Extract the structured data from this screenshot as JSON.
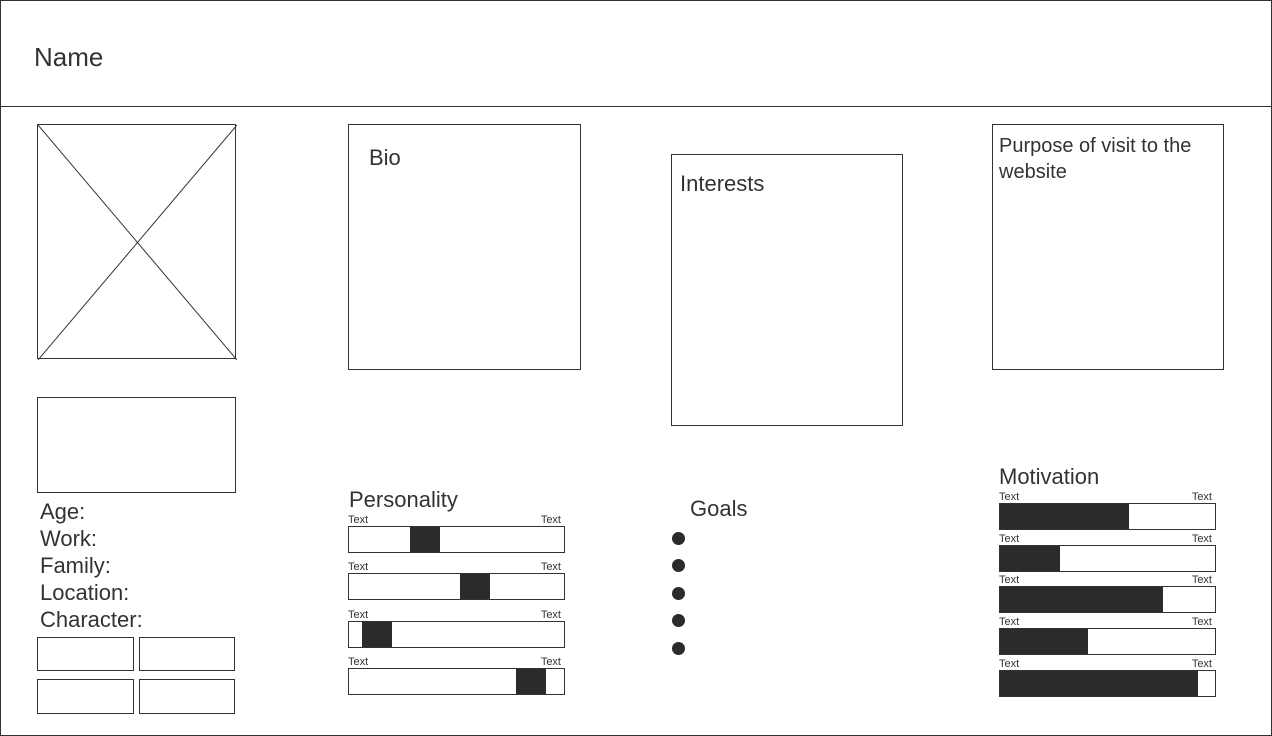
{
  "header": {
    "name": "Name"
  },
  "bio": {
    "title": "Bio"
  },
  "interests": {
    "title": "Interests"
  },
  "purpose": {
    "title": "Purpose of visit to the website"
  },
  "info": {
    "age": "Age:",
    "work": "Work:",
    "family": "Family:",
    "location": "Location:",
    "character": "Character:"
  },
  "personality": {
    "title": "Personality",
    "sliders": [
      {
        "left": "Text",
        "right": "Text",
        "value": 0.33
      },
      {
        "left": "Text",
        "right": "Text",
        "value": 0.6
      },
      {
        "left": "Text",
        "right": "Text",
        "value": 0.07
      },
      {
        "left": "Text",
        "right": "Text",
        "value": 0.9
      }
    ]
  },
  "goals": {
    "title": "Goals",
    "items": [
      "",
      "",
      "",
      "",
      ""
    ]
  },
  "motivation": {
    "title": "Motivation",
    "bars": [
      {
        "left": "Text",
        "right": "Text",
        "value": 0.6
      },
      {
        "left": "Text",
        "right": "Text",
        "value": 0.28
      },
      {
        "left": "Text",
        "right": "Text",
        "value": 0.76
      },
      {
        "left": "Text",
        "right": "Text",
        "value": 0.41
      },
      {
        "left": "Text",
        "right": "Text",
        "value": 0.92
      }
    ]
  }
}
